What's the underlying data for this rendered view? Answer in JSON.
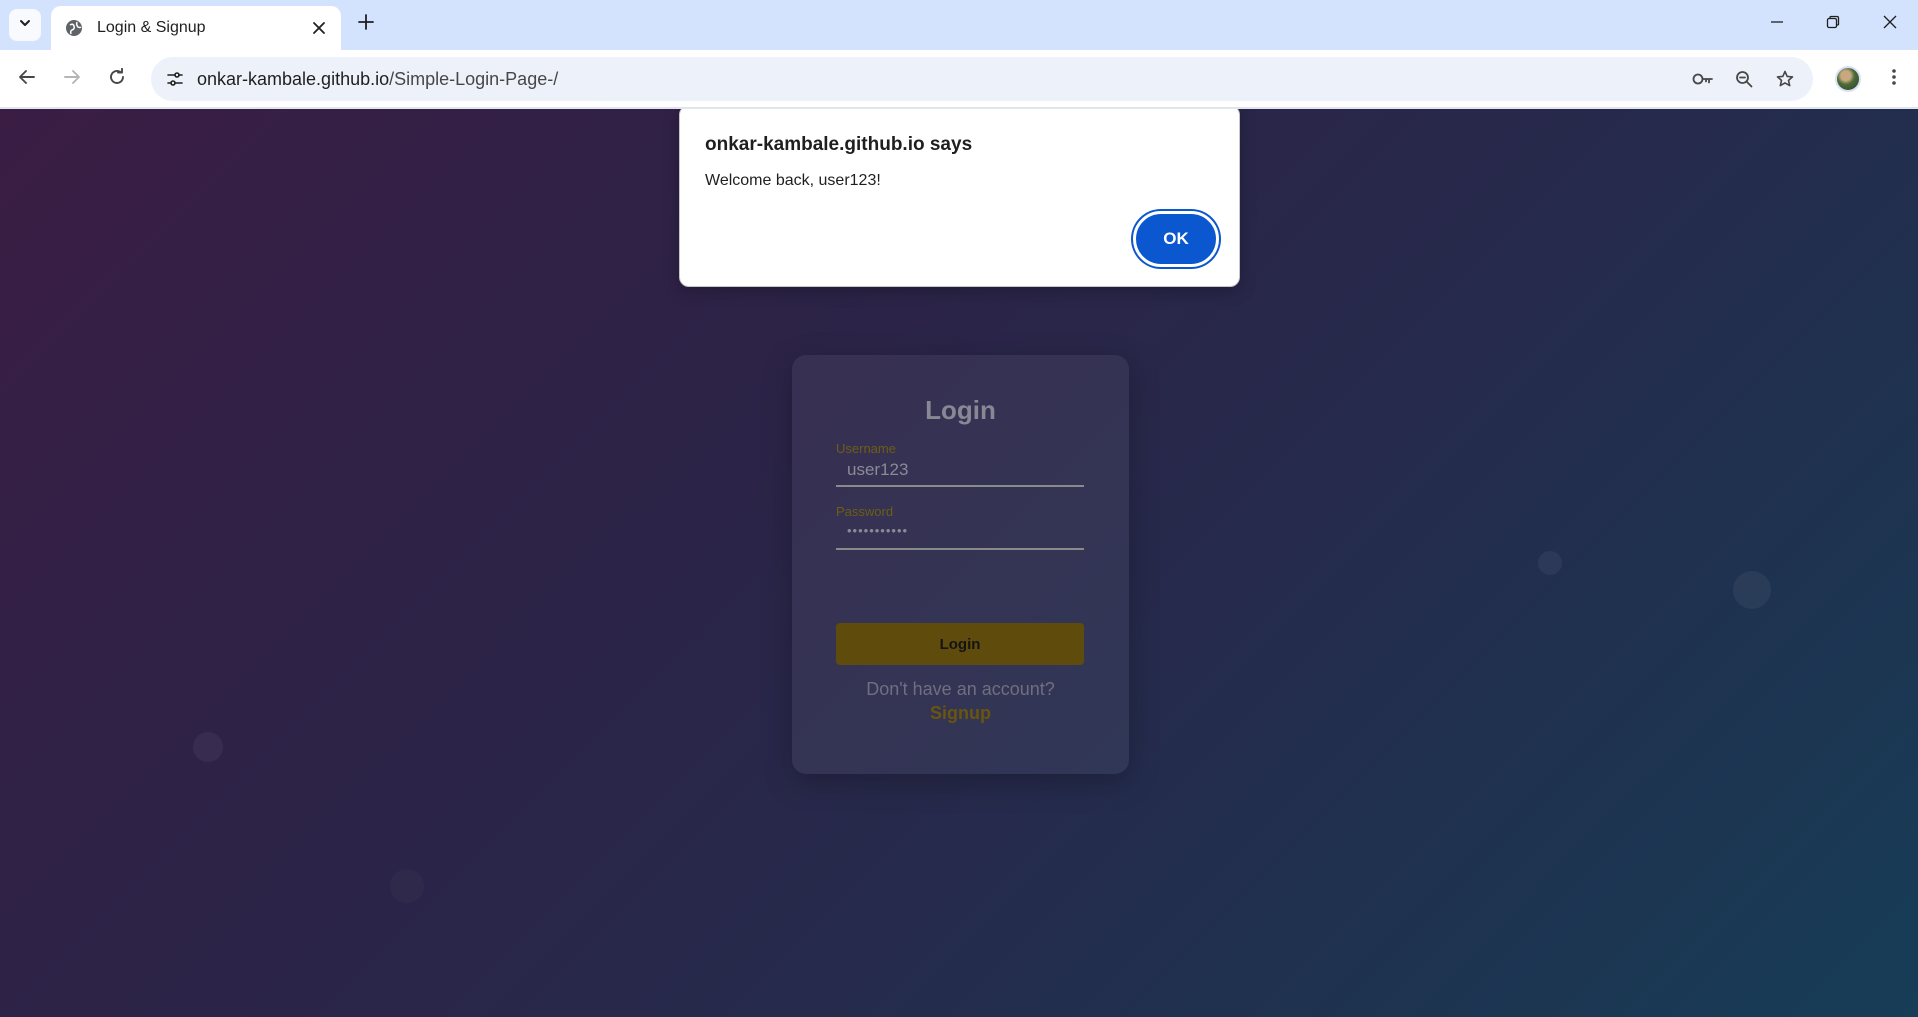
{
  "browser": {
    "tab": {
      "title": "Login & Signup"
    },
    "address_bar": {
      "url_host": "onkar-kambale.github.io",
      "url_path": "/Simple-Login-Page-/"
    }
  },
  "page": {
    "background_colors": [
      "#3b1d44",
      "#173d57"
    ],
    "login_form": {
      "heading": "Login",
      "username": {
        "label": "Username",
        "value": "user123"
      },
      "password": {
        "label": "Password",
        "value": "•••••••••••"
      },
      "submit_label": "Login",
      "signup_prompt": "Don't have an account?",
      "signup_link": "Signup",
      "accent_color": "#ffc107"
    }
  },
  "dialog": {
    "title": "onkar-kambale.github.io says",
    "message": "Welcome back, user123!",
    "ok_label": "OK",
    "button_color": "#0b57d0"
  }
}
